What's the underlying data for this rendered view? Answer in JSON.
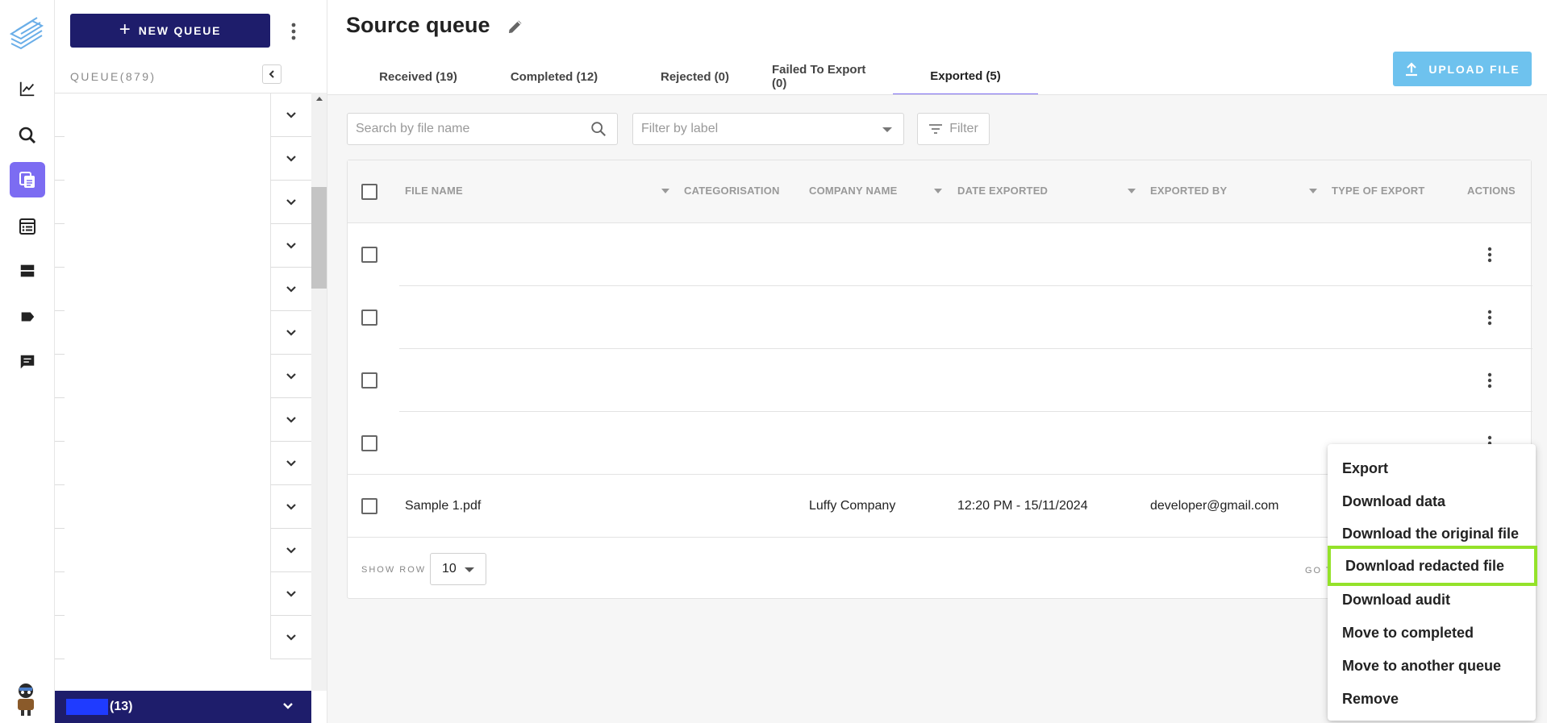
{
  "sidebar": {
    "new_queue_label": "NEW QUEUE",
    "queue_label": "QUEUE(879)",
    "rows": 13,
    "active_queue_count": "(13)"
  },
  "header": {
    "title": "Source queue",
    "upload_label": "UPLOAD FILE"
  },
  "tabs": [
    {
      "label": "Received (19)",
      "active": false
    },
    {
      "label": "Completed (12)",
      "active": false
    },
    {
      "label": "Rejected (0)",
      "active": false
    },
    {
      "label": "Failed To Export (0)",
      "active": false
    },
    {
      "label": "Exported (5)",
      "active": true
    }
  ],
  "toolbar": {
    "search_placeholder": "Search by file name",
    "label_placeholder": "Filter by label",
    "filter_label": "Filter"
  },
  "table": {
    "columns": [
      "FILE NAME",
      "CATEGORISATION",
      "COMPANY NAME",
      "DATE EXPORTED",
      "EXPORTED BY",
      "TYPE OF EXPORT",
      "ACTIONS"
    ],
    "rows": [
      {
        "file_name": "",
        "company": "",
        "date": "",
        "exported_by": ""
      },
      {
        "file_name": "",
        "company": "",
        "date": "",
        "exported_by": ""
      },
      {
        "file_name": "",
        "company": "",
        "date": "",
        "exported_by": ""
      },
      {
        "file_name": "",
        "company": "",
        "date": "",
        "exported_by": ""
      },
      {
        "file_name": "Sample 1.pdf",
        "company": "Luffy Company",
        "date": "12:20 PM - 15/11/2024",
        "exported_by": "developer@gmail.com"
      }
    ],
    "show_row_label": "SHOW ROW",
    "page_size": "10",
    "goto_label": "GO T"
  },
  "menu": {
    "items": [
      "Export",
      "Download data",
      "Download the original file",
      "Download redacted file",
      "Download audit",
      "Move to completed",
      "Move to another queue",
      "Remove"
    ],
    "highlighted_index": 3
  },
  "colors": {
    "primary": "#1e1d6b",
    "accent": "#7c6cf2",
    "upload": "#6ec2ee",
    "highlight": "#94e22a"
  }
}
